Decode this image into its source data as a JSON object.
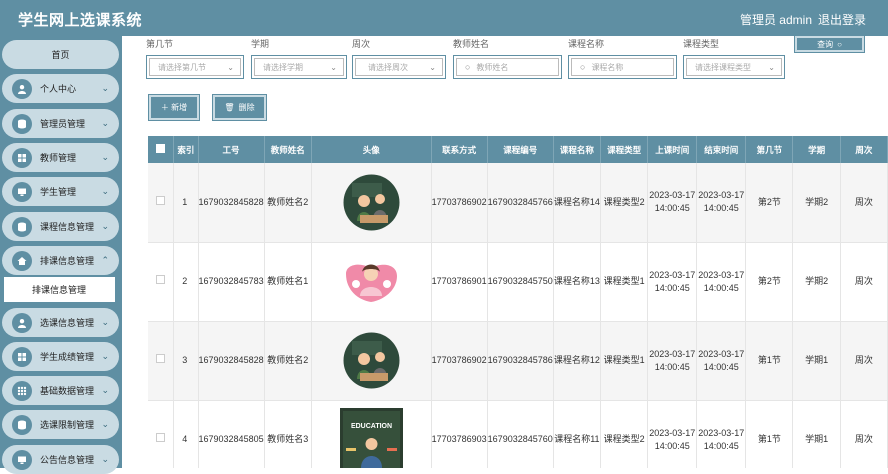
{
  "header": {
    "title": "学生网上选课系统",
    "admin": "管理员 admin",
    "logout": "退出登录"
  },
  "sidebar": {
    "home": "首页",
    "items": [
      {
        "label": "个人中心",
        "icon": "user-icon"
      },
      {
        "label": "管理员管理",
        "icon": "cylinder-icon"
      },
      {
        "label": "教师管理",
        "icon": "grid-icon"
      },
      {
        "label": "学生管理",
        "icon": "monitor-icon"
      },
      {
        "label": "课程信息管理",
        "icon": "cylinder-icon"
      },
      {
        "label": "排课信息管理",
        "icon": "home-icon"
      },
      {
        "label": "选课信息管理",
        "icon": "user-icon"
      },
      {
        "label": "学生成绩管理",
        "icon": "grid-icon"
      },
      {
        "label": "基础数据管理",
        "icon": "grid-icon"
      },
      {
        "label": "选课限制管理",
        "icon": "cylinder-icon"
      },
      {
        "label": "公告信息管理",
        "icon": "monitor-icon"
      }
    ],
    "sub_item": "排课信息管理"
  },
  "filters": {
    "section": {
      "label": "第几节",
      "placeholder": "请选择第几节"
    },
    "term": {
      "label": "学期",
      "placeholder": "请选择学期"
    },
    "week": {
      "label": "周次",
      "placeholder": "请选择周次"
    },
    "teacher": {
      "label": "教师姓名",
      "placeholder": "教师姓名"
    },
    "course_name": {
      "label": "课程名称",
      "placeholder": "课程名称"
    },
    "course_type": {
      "label": "课程类型",
      "placeholder": "请选择课程类型"
    },
    "search_btn": "查询"
  },
  "actions": {
    "add": "＋ 新增",
    "delete": "删除"
  },
  "table": {
    "headers": [
      "索引",
      "工号",
      "教师姓名",
      "头像",
      "联系方式",
      "课程编号",
      "课程名称",
      "课程类型",
      "上课时间",
      "结束时间",
      "第几节",
      "学期",
      "周次"
    ],
    "rows": [
      {
        "index": "1",
        "id": "1679032845828",
        "name": "教师姓名2",
        "phone": "17703786902",
        "code": "1679032845766",
        "course": "课程名称14",
        "type": "课程类型2",
        "start": "2023-03-17 14:00:45",
        "end": "2023-03-17 14:00:45",
        "section": "第2节",
        "term": "学期2",
        "week": "周次"
      },
      {
        "index": "2",
        "id": "1679032845783",
        "name": "教师姓名1",
        "phone": "17703786901",
        "code": "1679032845750",
        "course": "课程名称13",
        "type": "课程类型1",
        "start": "2023-03-17 14:00:45",
        "end": "2023-03-17 14:00:45",
        "section": "第2节",
        "term": "学期2",
        "week": "周次"
      },
      {
        "index": "3",
        "id": "1679032845828",
        "name": "教师姓名2",
        "phone": "17703786902",
        "code": "1679032845786",
        "course": "课程名称12",
        "type": "课程类型1",
        "start": "2023-03-17 14:00:45",
        "end": "2023-03-17 14:00:45",
        "section": "第1节",
        "term": "学期1",
        "week": "周次"
      },
      {
        "index": "4",
        "id": "1679032845805",
        "name": "教师姓名3",
        "phone": "17703786903",
        "code": "1679032845760",
        "course": "课程名称11",
        "type": "课程类型2",
        "start": "2023-03-17 14:00:45",
        "end": "2023-03-17 14:00:45",
        "section": "第1节",
        "term": "学期1",
        "week": "周次"
      }
    ],
    "avatar_texts": {
      "education": "EDUCATION"
    }
  },
  "colors": {
    "primary": "#5f8fa3",
    "light": "#c9dbe3"
  }
}
